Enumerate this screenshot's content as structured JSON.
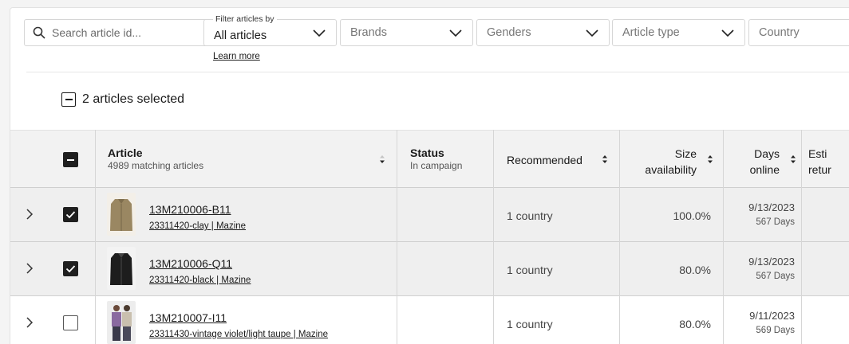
{
  "search": {
    "placeholder": "Search article id..."
  },
  "filters": {
    "label": "Filter articles by",
    "articles": "All articles",
    "brands": "Brands",
    "genders": "Genders",
    "article_type": "Article type",
    "country": "Country",
    "learn_more": "Learn more"
  },
  "selection": {
    "text": "2 articles selected"
  },
  "table": {
    "headers": {
      "article": "Article",
      "article_sub": "4989 matching articles",
      "status": "Status",
      "status_sub": "In campaign",
      "recommended": "Recommended",
      "size_1": "Size",
      "size_2": "availability",
      "days_1": "Days",
      "days_2": "online",
      "est_1": "Esti",
      "est_2": "retur"
    },
    "rows": [
      {
        "id": "13M210006-B11",
        "desc": "23311420-clay | Mazine",
        "recommended": "1 country",
        "size": "100.0%",
        "date": "9/13/2023",
        "days": "567 Days",
        "checked": true
      },
      {
        "id": "13M210006-Q11",
        "desc": "23311420-black | Mazine",
        "recommended": "1 country",
        "size": "80.0%",
        "date": "9/13/2023",
        "days": "567 Days",
        "checked": true
      },
      {
        "id": "13M210007-I11",
        "desc": "23311430-vintage violet/light taupe | Mazine",
        "recommended": "1 country",
        "size": "80.0%",
        "date": "9/11/2023",
        "days": "569 Days",
        "checked": false
      }
    ]
  },
  "icons": {
    "search": "search-icon",
    "chevron": "chevron-down-icon",
    "expand": "chevron-right-icon",
    "sort": "sort-icon"
  },
  "colors": {
    "selected_row": "#efefef",
    "header_bg": "#f2f2f2",
    "checkbox": "#1f1f1f"
  }
}
